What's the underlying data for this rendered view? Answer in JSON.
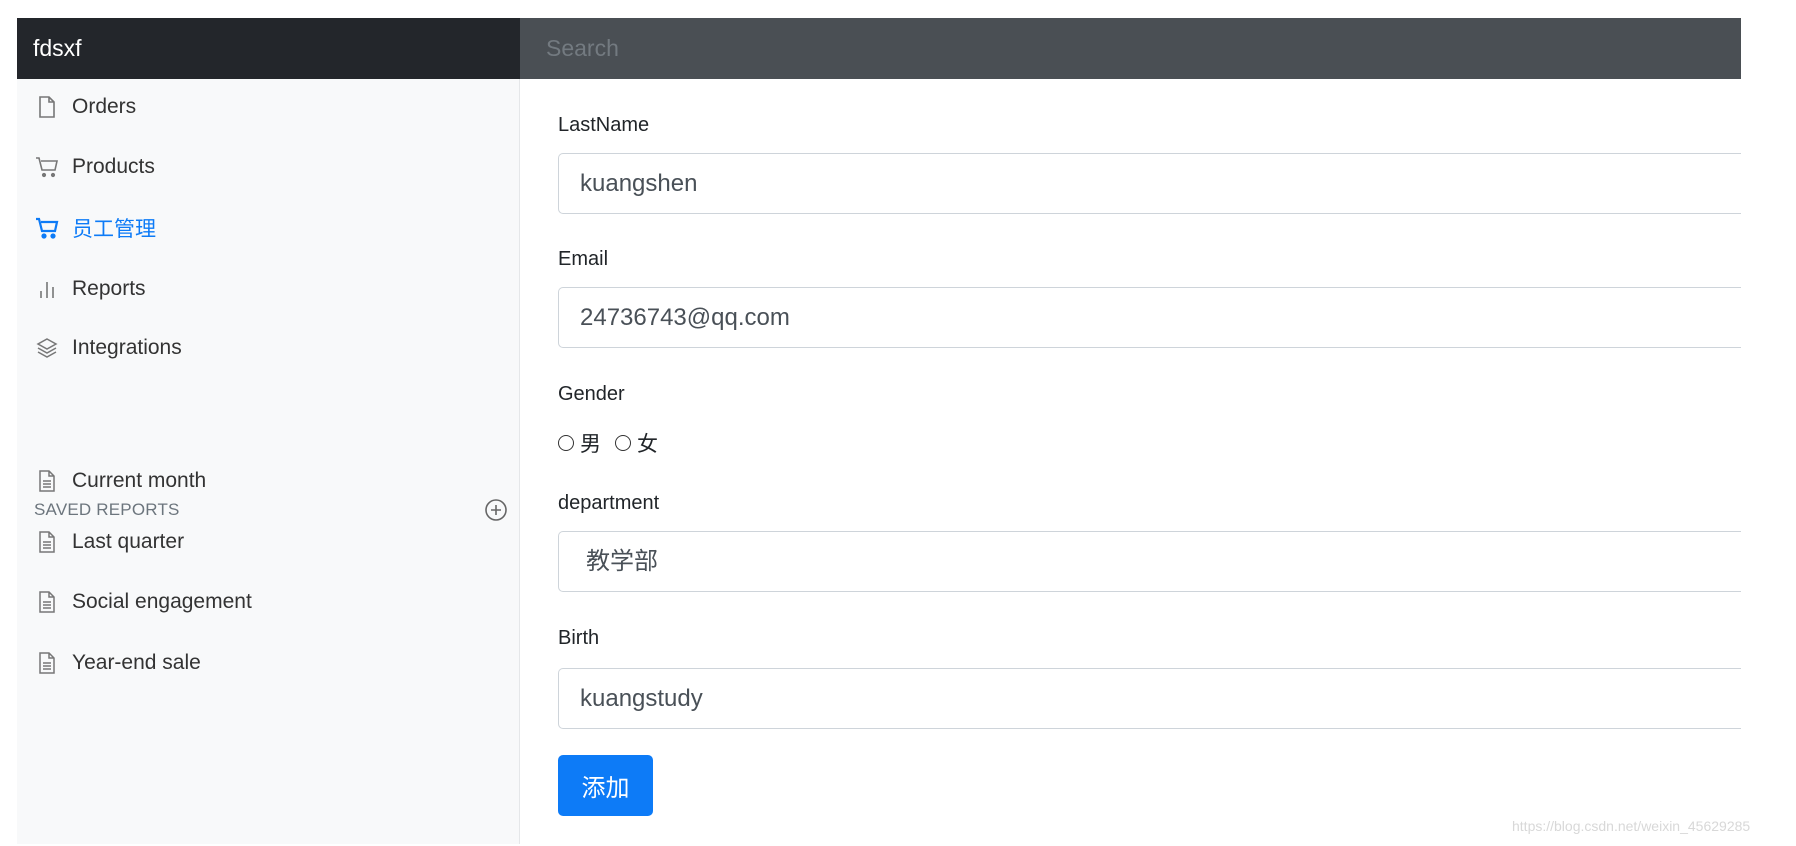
{
  "header": {
    "brand": "fdsxf",
    "search_placeholder": "Search"
  },
  "sidebar": {
    "items": [
      {
        "label": "Orders",
        "icon": "file-icon"
      },
      {
        "label": "Products",
        "icon": "cart-icon"
      },
      {
        "label": "员工管理",
        "icon": "cart-icon",
        "active": true
      },
      {
        "label": "Reports",
        "icon": "bar-chart-icon"
      },
      {
        "label": "Integrations",
        "icon": "layers-icon"
      }
    ],
    "saved_heading": "SAVED REPORTS",
    "saved": [
      {
        "label": "Current month"
      },
      {
        "label": "Last quarter"
      },
      {
        "label": "Social engagement"
      },
      {
        "label": "Year-end sale"
      }
    ]
  },
  "form": {
    "lastname_label": "LastName",
    "lastname_value": "kuangshen",
    "email_label": "Email",
    "email_value": "24736743@qq.com",
    "gender_label": "Gender",
    "gender_options": [
      "男",
      "女"
    ],
    "department_label": "department",
    "department_value": "教学部",
    "birth_label": "Birth",
    "birth_value": "kuangstudy",
    "submit_label": "添加"
  },
  "colors": {
    "accent": "#0d7bf7",
    "topbar": "#23262b"
  },
  "watermark": "https://blog.csdn.net/weixin_45629285"
}
